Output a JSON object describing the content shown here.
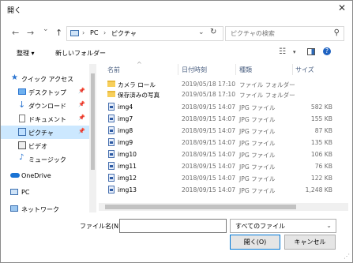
{
  "window": {
    "title": "開く",
    "close_label": "✕"
  },
  "nav": {
    "back": "←",
    "forward": "→",
    "recent": "⌄",
    "up": "↑",
    "breadcrumb": [
      "PC",
      "ピクチャ"
    ],
    "search_placeholder": "ピクチャの検索"
  },
  "toolbar": {
    "organize": "整理 ▾",
    "new_folder": "新しいフォルダー",
    "help": "?"
  },
  "sidebar": {
    "items": [
      {
        "label": "クイック アクセス",
        "icon": "star-icon"
      },
      {
        "label": "デスクトップ",
        "icon": "desktop-icon",
        "pinned": true
      },
      {
        "label": "ダウンロード",
        "icon": "download-icon",
        "pinned": true
      },
      {
        "label": "ドキュメント",
        "icon": "document-icon",
        "pinned": true
      },
      {
        "label": "ピクチャ",
        "icon": "pictures-icon",
        "pinned": true,
        "selected": true
      },
      {
        "label": "ビデオ",
        "icon": "video-icon"
      },
      {
        "label": "ミュージック",
        "icon": "music-icon"
      },
      {
        "label": "OneDrive",
        "icon": "cloud-icon"
      },
      {
        "label": "PC",
        "icon": "computer-icon"
      },
      {
        "label": "ネットワーク",
        "icon": "network-icon"
      }
    ]
  },
  "files": {
    "headers": {
      "name": "名前",
      "date": "日付時刻",
      "type": "種類",
      "size": "サイズ"
    },
    "rows": [
      {
        "name": "カメラ ロール",
        "date": "2019/05/18 17:10",
        "type": "ファイル フォルダー",
        "size": "",
        "kind": "folder"
      },
      {
        "name": "保存済みの写真",
        "date": "2019/05/18 17:10",
        "type": "ファイル フォルダー",
        "size": "",
        "kind": "folder"
      },
      {
        "name": "img4",
        "date": "2018/09/15 14:07",
        "type": "JPG ファイル",
        "size": "582 KB",
        "kind": "jpg"
      },
      {
        "name": "img7",
        "date": "2018/09/15 14:07",
        "type": "JPG ファイル",
        "size": "155 KB",
        "kind": "jpg"
      },
      {
        "name": "img8",
        "date": "2018/09/15 14:07",
        "type": "JPG ファイル",
        "size": "87 KB",
        "kind": "jpg"
      },
      {
        "name": "img9",
        "date": "2018/09/15 14:07",
        "type": "JPG ファイル",
        "size": "135 KB",
        "kind": "jpg"
      },
      {
        "name": "img10",
        "date": "2018/09/15 14:07",
        "type": "JPG ファイル",
        "size": "106 KB",
        "kind": "jpg"
      },
      {
        "name": "img11",
        "date": "2018/09/15 14:07",
        "type": "JPG ファイル",
        "size": "76 KB",
        "kind": "jpg"
      },
      {
        "name": "img12",
        "date": "2018/09/15 14:07",
        "type": "JPG ファイル",
        "size": "122 KB",
        "kind": "jpg"
      },
      {
        "name": "img13",
        "date": "2018/09/15 14:07",
        "type": "JPG ファイル",
        "size": "1,248 KB",
        "kind": "jpg"
      }
    ]
  },
  "footer": {
    "filename_label": "ファイル名(N):",
    "filename_value": "",
    "filetype_value": "すべてのファイル",
    "open_label": "開く(O)",
    "cancel_label": "キャンセル"
  }
}
